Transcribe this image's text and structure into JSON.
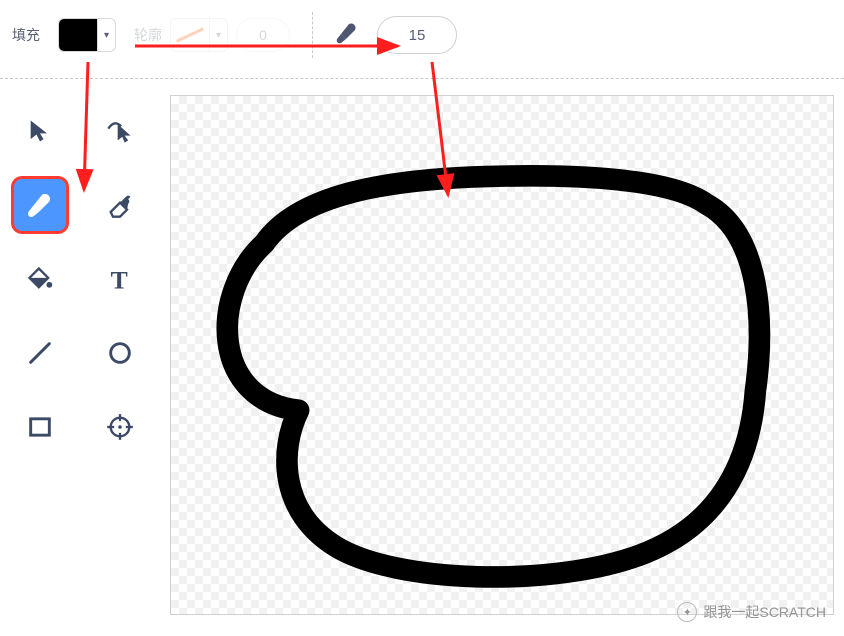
{
  "toolbar": {
    "fill_label": "填充",
    "fill_color": "#000000",
    "outline_label": "轮廓",
    "outline_width": "0",
    "brush_size": "15"
  },
  "tools": {
    "select": "select",
    "reshape": "reshape",
    "brush": "brush",
    "eraser": "eraser",
    "fill": "fill",
    "text": "text",
    "line": "line",
    "circle": "circle",
    "rect": "rect",
    "crosshair": "crosshair"
  },
  "watermark": "跟我一起SCRATCH"
}
